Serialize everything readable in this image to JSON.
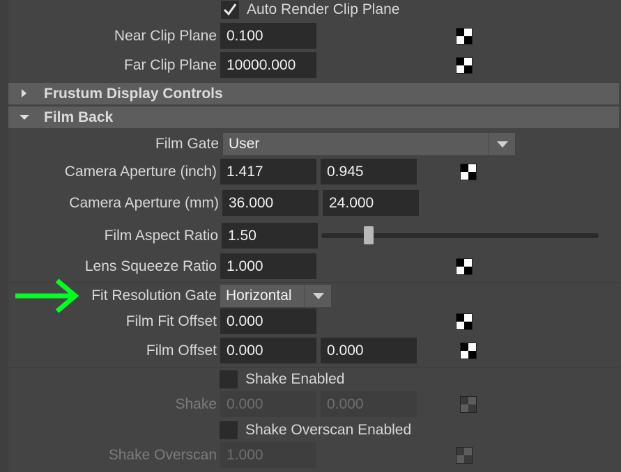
{
  "clip": {
    "auto_render_label": "Auto Render Clip Plane",
    "auto_render_checked": true,
    "near_label": "Near Clip Plane",
    "near_value": "0.100",
    "far_label": "Far Clip Plane",
    "far_value": "10000.000"
  },
  "sections": {
    "frustum": "Frustum Display Controls",
    "filmback": "Film Back"
  },
  "filmback": {
    "film_gate_label": "Film Gate",
    "film_gate_value": "User",
    "aperture_inch_label": "Camera Aperture (inch)",
    "aperture_inch_x": "1.417",
    "aperture_inch_y": "0.945",
    "aperture_mm_label": "Camera Aperture (mm)",
    "aperture_mm_x": "36.000",
    "aperture_mm_y": "24.000",
    "aspect_label": "Film Aspect Ratio",
    "aspect_value": "1.50",
    "aspect_slider_fraction": 0.16,
    "squeeze_label": "Lens Squeeze Ratio",
    "squeeze_value": "1.000",
    "fit_gate_label": "Fit Resolution Gate",
    "fit_gate_value": "Horizontal",
    "fit_offset_label": "Film Fit Offset",
    "fit_offset_value": "0.000",
    "film_offset_label": "Film Offset",
    "film_offset_x": "0.000",
    "film_offset_y": "0.000"
  },
  "shake": {
    "enabled_label": "Shake Enabled",
    "shake_label": "Shake",
    "shake_x": "0.000",
    "shake_y": "0.000",
    "overscan_enabled_label": "Shake Overscan Enabled",
    "overscan_label": "Shake Overscan",
    "overscan_value": "1.000"
  },
  "annotation": {
    "arrow_icon": "green-arrow-right-icon",
    "arrow_color": "#00ff22"
  },
  "colors": {
    "panel_bg": "#444444",
    "field_bg": "#2b2b2b",
    "section_bg": "#5d5d5d"
  }
}
